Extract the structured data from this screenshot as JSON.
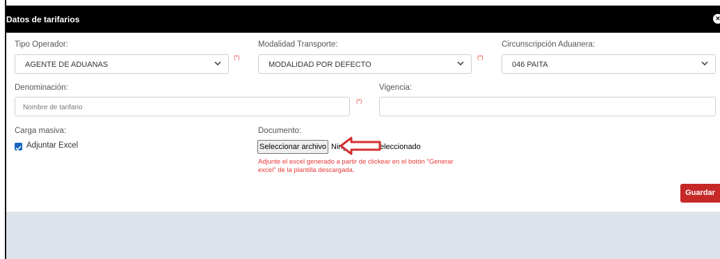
{
  "header": {
    "title": "Datos de tarifarios",
    "close_glyph": "×"
  },
  "fields": {
    "tipo_operador": {
      "label": "Tipo Operador:",
      "value": "AGENTE DE ADUANAS",
      "required": "(*)"
    },
    "modalidad": {
      "label": "Modalidad Transporte:",
      "value": "MODALIDAD POR DEFECTO",
      "required": "(*)"
    },
    "circunscripcion": {
      "label": "Circunscripción Aduanera:",
      "value": "046 PAITA"
    },
    "denominacion": {
      "label": "Denominación:",
      "placeholder": "Nombre de tarifario",
      "required": "(*)"
    },
    "vigencia": {
      "label": "Vigencia:",
      "value": ""
    },
    "carga_masiva": {
      "label": "Carga masiva:",
      "checkbox_label": "Adjuntar Excel",
      "checked": true
    },
    "documento": {
      "label": "Documento:",
      "button_label": "Seleccionar archivo",
      "status_prefix": "Ning",
      "status_suffix": "eleccionado",
      "hint": "Adjunte el excel generado a partir de clickear en el botón \"Generar excel\" de la plantilla descargada."
    }
  },
  "actions": {
    "save_label": "Guardar"
  },
  "colors": {
    "header": "#000000",
    "required": "#e53935",
    "save": "#c62828",
    "arrow": "#d32f2f",
    "checkbox": "#1565c0",
    "footer": "#dde3ea"
  },
  "icons": {
    "select_chevron": "chevron-down-icon",
    "close": "close-icon",
    "annotation": "arrow-left-icon"
  }
}
